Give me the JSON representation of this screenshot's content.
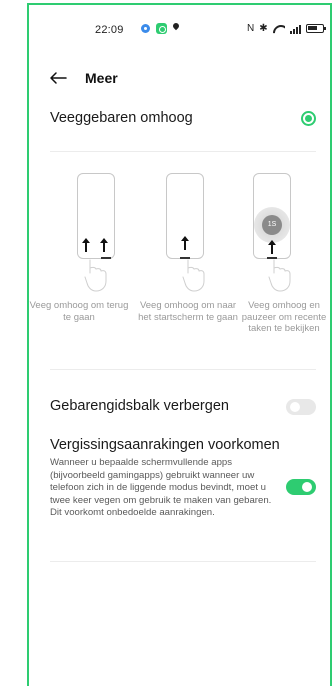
{
  "status_bar": {
    "time": "22:09",
    "nfc": "N",
    "bluetooth": "✱",
    "icons": [
      "gear-icon",
      "app-icon",
      "location-icon",
      "nfc-icon",
      "bluetooth-icon",
      "wifi-icon",
      "signal-icon",
      "battery-icon"
    ]
  },
  "header": {
    "title": "Meer"
  },
  "main_toggle": {
    "label": "Veeggebaren omhoog",
    "selected": true
  },
  "gestures": [
    {
      "caption": "Veeg omhoog om terug te gaan"
    },
    {
      "caption": "Veeg omhoog om naar het startscherm te gaan"
    },
    {
      "caption": "Veeg omhoog en pauzeer om recente taken te bekijken",
      "hold_label": "1S"
    }
  ],
  "settings": {
    "hide_bar": {
      "label": "Gebarengidsbalk verbergen",
      "enabled": false
    },
    "accidental": {
      "label": "Vergissingsaanrakingen voorkomen",
      "description": "Wanneer u bepaalde schermvullende apps (bijvoorbeeld gamingapps) gebruikt wanneer uw telefoon zich in de liggende modus bevindt, moet u twee keer vegen om gebruik te maken van gebaren. Dit voorkomt onbedoelde aanrakingen.",
      "enabled": true
    }
  },
  "colors": {
    "accent": "#2ecc71",
    "caption": "#9a9a9a",
    "divider": "#ececec"
  }
}
